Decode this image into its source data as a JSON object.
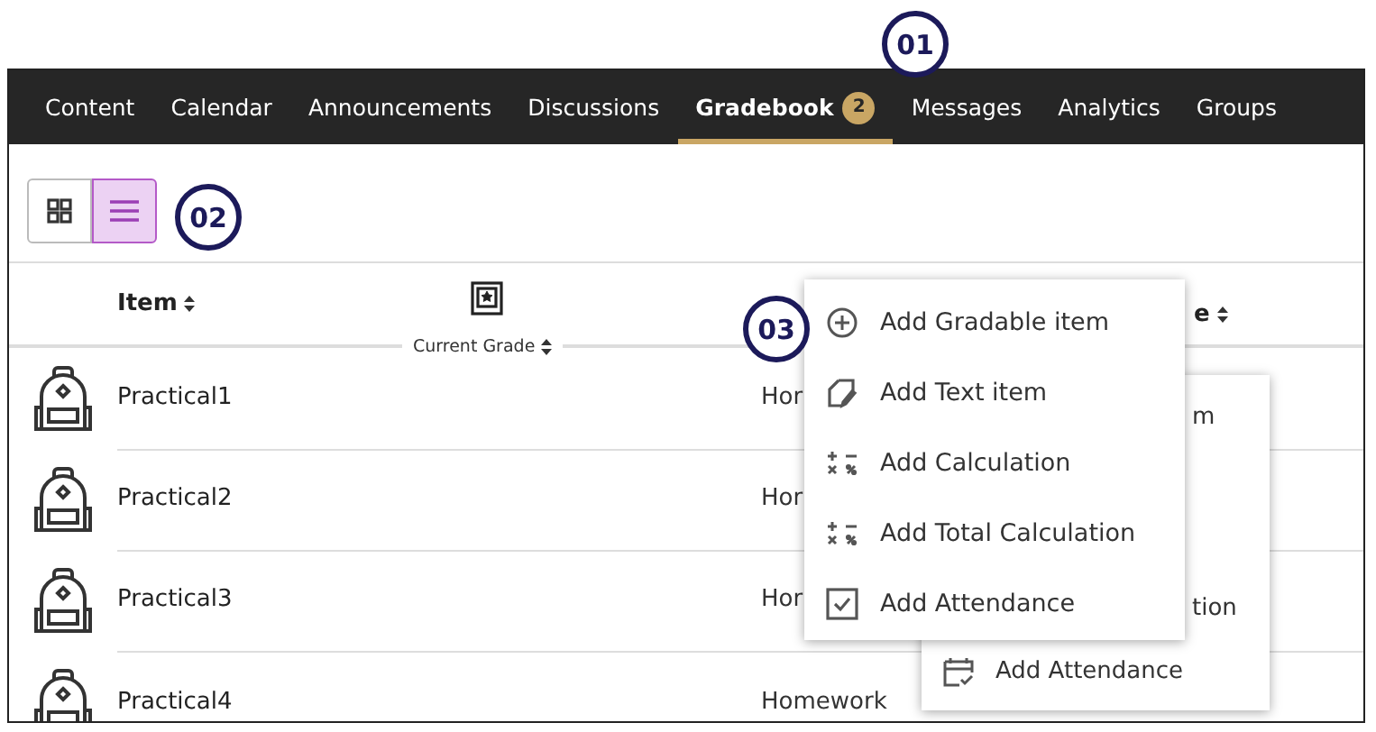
{
  "nav": {
    "tabs": [
      {
        "label": "Content",
        "selected": false
      },
      {
        "label": "Calendar",
        "selected": false
      },
      {
        "label": "Announcements",
        "selected": false
      },
      {
        "label": "Discussions",
        "selected": false
      },
      {
        "label": "Gradebook",
        "selected": true,
        "badge": "2"
      },
      {
        "label": "Messages",
        "selected": false
      },
      {
        "label": "Analytics",
        "selected": false
      },
      {
        "label": "Groups",
        "selected": false
      }
    ]
  },
  "view_toggle": [
    {
      "kind": "grid",
      "selected": false
    },
    {
      "kind": "list",
      "selected": true
    }
  ],
  "table": {
    "columns": [
      {
        "label": "Item"
      },
      {
        "label": "Current Grade"
      },
      {
        "label": "e"
      }
    ],
    "rows": [
      {
        "item": "Practical1",
        "category": "Hor"
      },
      {
        "item": "Practical2",
        "category": "Hor"
      },
      {
        "item": "Practical3",
        "category": "Hor"
      },
      {
        "item": "Practical4",
        "category": "Homework"
      }
    ]
  },
  "back_menu": {
    "items": [
      {
        "kind": "partial",
        "label": "m"
      },
      {
        "kind": "partial",
        "label": "tion"
      },
      {
        "kind": "attendance",
        "label": "Add Attendance"
      }
    ]
  },
  "add_menu": {
    "items": [
      {
        "kind": "gradable",
        "label": "Add Gradable item"
      },
      {
        "kind": "text",
        "label": "Add Text item"
      },
      {
        "kind": "calculation",
        "label": "Add Calculation"
      },
      {
        "kind": "calculation",
        "label": "Add Total Calculation"
      },
      {
        "kind": "attendance",
        "label": "Add Attendance"
      }
    ]
  },
  "callouts": [
    "01",
    "02",
    "03"
  ]
}
